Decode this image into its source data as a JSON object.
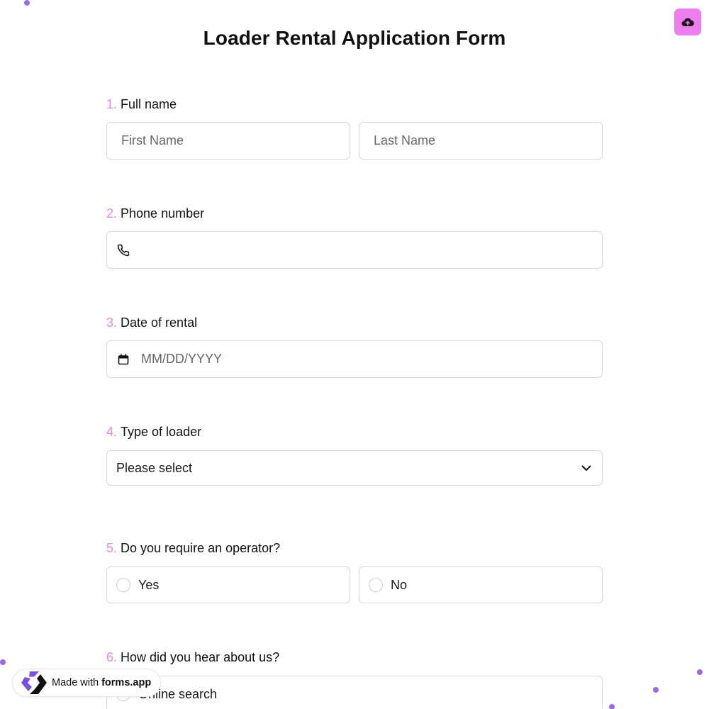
{
  "form": {
    "title": "Loader Rental Application Form"
  },
  "questions": [
    {
      "number": "1.",
      "label": "Full name"
    },
    {
      "number": "2.",
      "label": "Phone number"
    },
    {
      "number": "3.",
      "label": "Date of rental"
    },
    {
      "number": "4.",
      "label": "Type of loader"
    },
    {
      "number": "5.",
      "label": "Do you require an operator?"
    },
    {
      "number": "6.",
      "label": "How did you hear about us?"
    }
  ],
  "full_name": {
    "first_placeholder": "First Name",
    "last_placeholder": "Last Name"
  },
  "date": {
    "placeholder": "MM/DD/YYYY"
  },
  "loader_type": {
    "selected": "Please select"
  },
  "operator": {
    "options": [
      "Yes",
      "No"
    ]
  },
  "heard": {
    "options": [
      "Online search"
    ]
  },
  "badge": {
    "prefix": "Made with",
    "brand": "forms.app"
  },
  "icons": {
    "upload": "cloud-upload-icon",
    "phone": "phone-icon",
    "calendar": "calendar-icon",
    "chevron": "chevron-down-icon",
    "logo": "forms-app-logo-icon"
  },
  "colors": {
    "accent": "#ee7ef0",
    "number": "#e58ae8",
    "dots": "#9b6be0",
    "logo": "#7b4fe0"
  }
}
